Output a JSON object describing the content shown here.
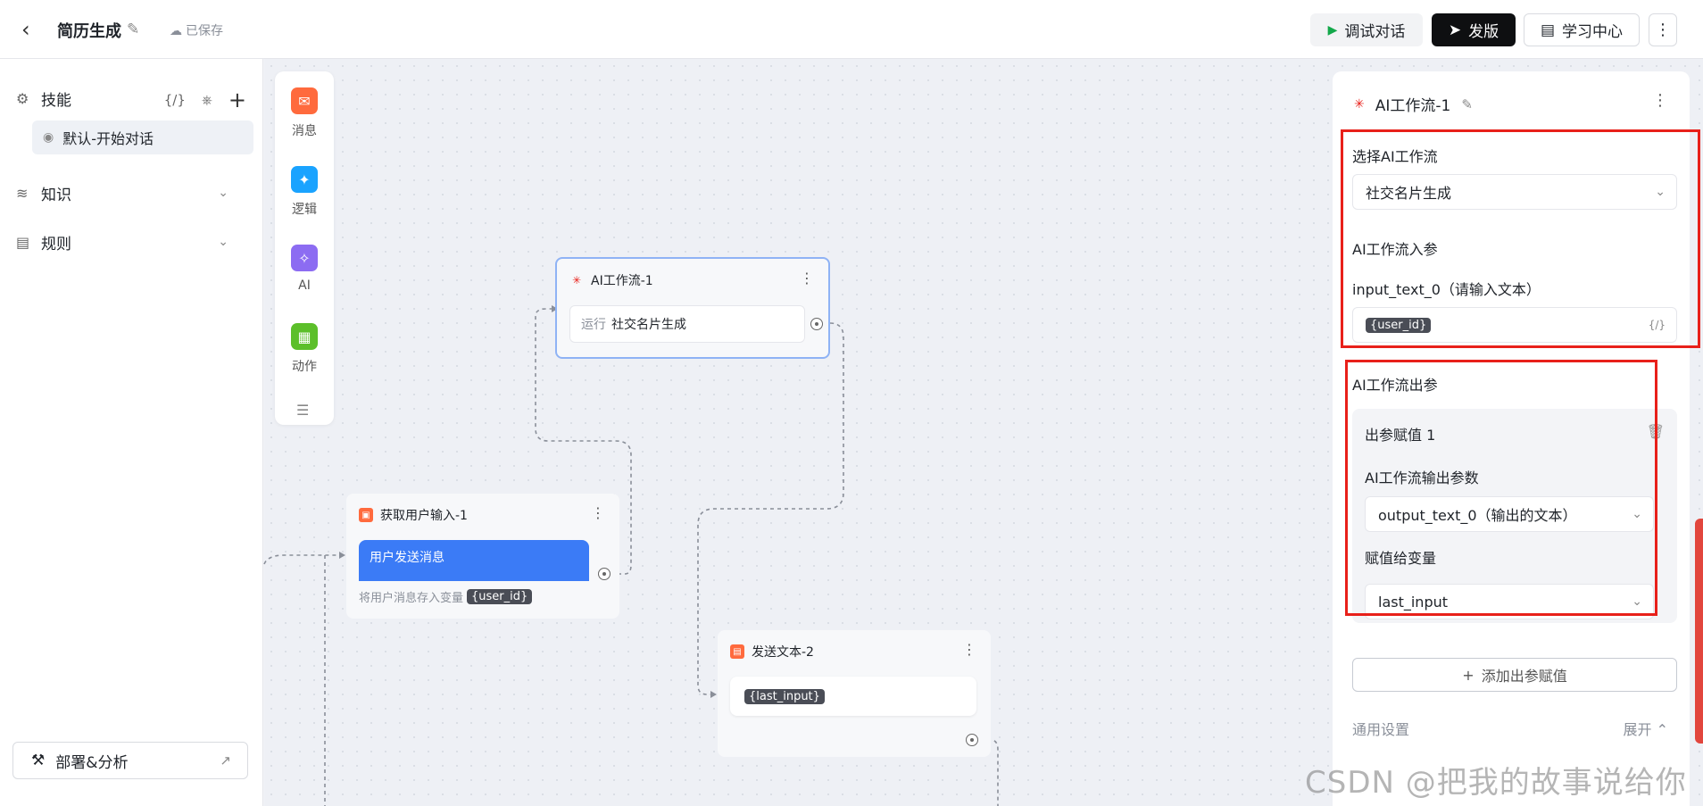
{
  "header": {
    "back_icon": "chevron-left-icon",
    "title": "简历生成",
    "saved_status": "已保存",
    "debug_label": "调试对话",
    "publish_label": "发版",
    "learn_label": "学习中心"
  },
  "sidebar": {
    "skill_label": "技能",
    "skill_var_icon": "{/}",
    "skill_item": "默认-开始对话",
    "knowledge_label": "知识",
    "rules_label": "规则",
    "deploy_label": "部署&分析"
  },
  "palette": {
    "items": [
      {
        "label": "消息",
        "icon": "chat-bubble-icon",
        "color": "#ff6a3d"
      },
      {
        "label": "逻辑",
        "icon": "bulb-icon",
        "color": "#1aa3ff"
      },
      {
        "label": "AI",
        "icon": "magic-wand-icon",
        "color": "#8c6cf2"
      },
      {
        "label": "动作",
        "icon": "grid-icon",
        "color": "#5cbf2a"
      }
    ]
  },
  "nodes": {
    "ai_flow": {
      "title": "AI工作流-1",
      "run_prefix": "运行",
      "run_value": "社交名片生成"
    },
    "user_input": {
      "title": "获取用户输入-1",
      "button": "用户发送消息",
      "note": "将用户消息存入变量",
      "var": "{user_id}"
    },
    "send_text": {
      "title": "发送文本-2",
      "var": "{last_input}"
    }
  },
  "panel": {
    "title": "AI工作流-1",
    "select_label": "选择AI工作流",
    "select_value": "社交名片生成",
    "input_params_label": "AI工作流入参",
    "input_param_name": "input_text_0（请输入文本）",
    "input_param_value": "{user_id}",
    "var_icon": "{/}",
    "output_params_label": "AI工作流出参",
    "out_item_title": "出参赋值 1",
    "out_param_label": "AI工作流输出参数",
    "out_param_value": "output_text_0（输出的文本）",
    "assign_label": "赋值给变量",
    "assign_value": "last_input",
    "add_label": "添加出参赋值",
    "general_label": "通用设置",
    "expand_label": "展开"
  },
  "watermark": "CSDN @把我的故事说给你",
  "colors": {
    "highlight": "#e8201a",
    "selected_node_border": "#8fb3f5",
    "primary_button": "#3b7bf6"
  }
}
